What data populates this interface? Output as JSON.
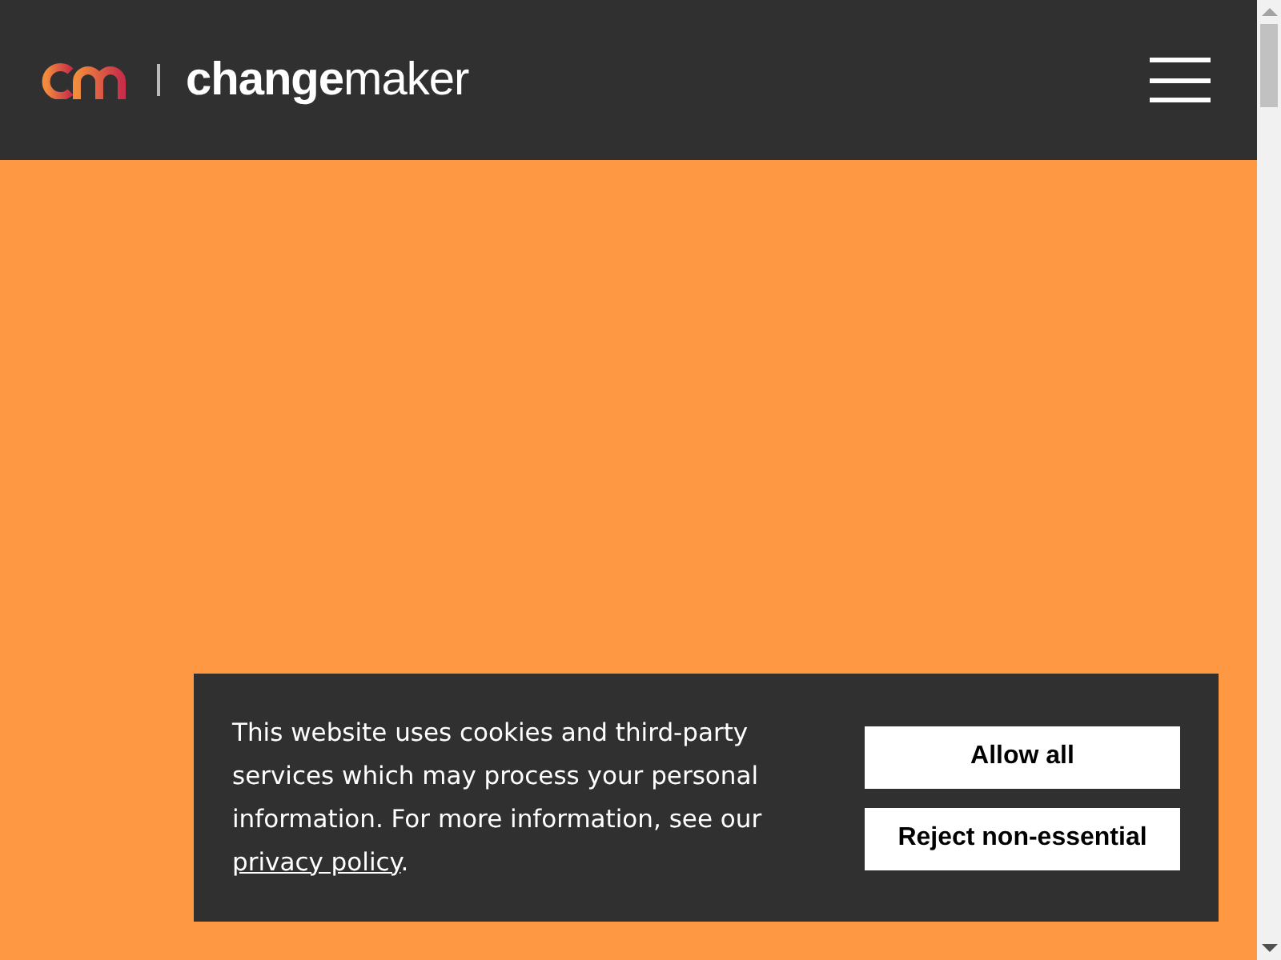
{
  "header": {
    "brand": "**change**maker"
  },
  "cookie_banner": {
    "message": "This website uses cookies and third-party services which may process your personal information. For more information, see our ",
    "link": "privacy policy",
    "message_end": ".",
    "buttons": [
      "Allow all",
      "Reject non-essential"
    ]
  }
}
